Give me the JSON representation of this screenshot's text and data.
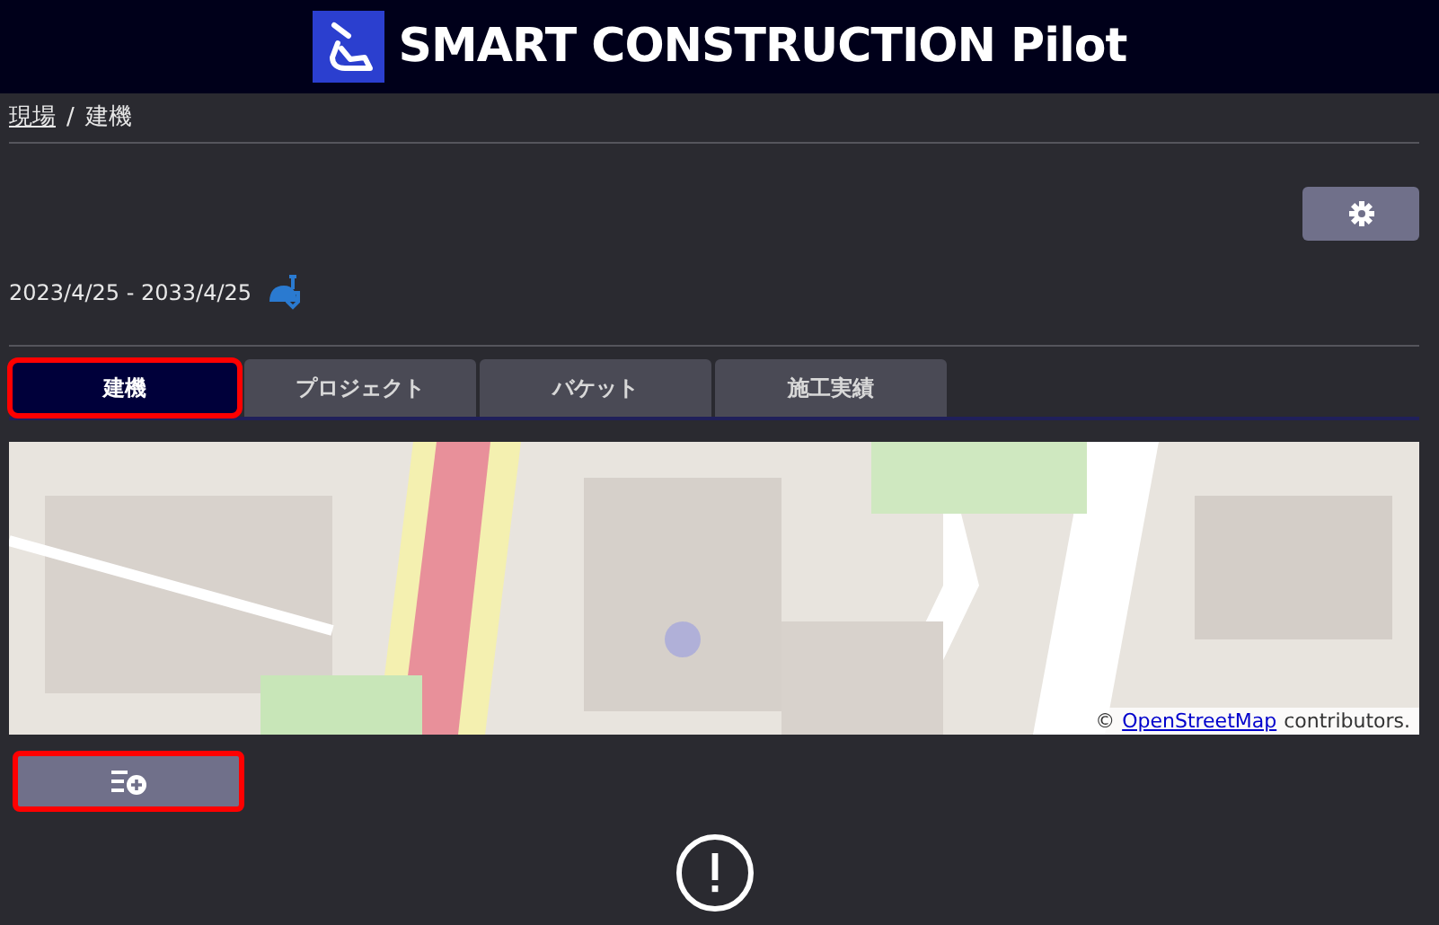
{
  "header": {
    "title": "SMART CONSTRUCTION Pilot"
  },
  "breadcrumb": [
    {
      "label": "現場",
      "link": true
    },
    {
      "label": "/",
      "link": false
    },
    {
      "label": "建機",
      "link": false
    }
  ],
  "period": "2023/4/25 - 2033/4/25",
  "tabs": [
    {
      "label": "建機",
      "selected": true,
      "highlighted": true
    },
    {
      "label": "プロジェクト",
      "selected": false,
      "highlighted": false
    },
    {
      "label": "バケット",
      "selected": false,
      "highlighted": false
    },
    {
      "label": "施工実績",
      "selected": false,
      "highlighted": false
    }
  ],
  "map": {
    "kind": "picture",
    "attribution": {
      "symbol": "©",
      "link": "OpenStreetMap",
      "text": "contributors."
    }
  },
  "add_button": {
    "highlighted": true
  }
}
